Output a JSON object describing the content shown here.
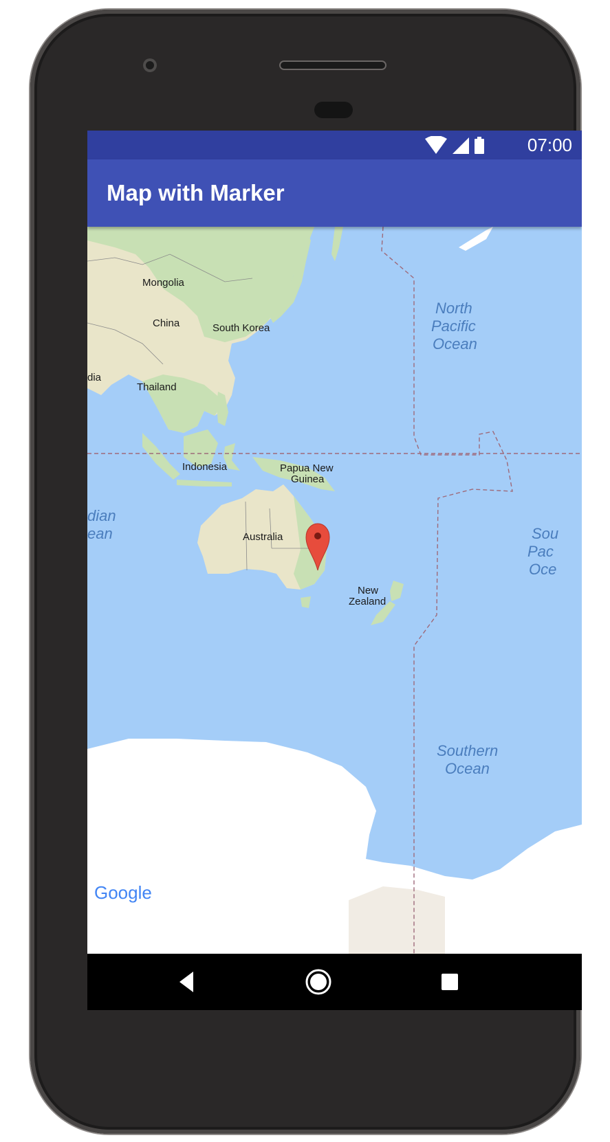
{
  "app": {
    "title": "Map with Marker"
  },
  "status_bar": {
    "time": "07:00",
    "icons": [
      "wifi-icon",
      "cell-signal-icon",
      "battery-icon"
    ]
  },
  "map": {
    "labels": {
      "mongolia": "Mongolia",
      "china": "China",
      "south_korea": "South Korea",
      "india_partial": "dia",
      "thailand": "Thailand",
      "indonesia": "Indonesia",
      "papua_line1": "Papua New",
      "papua_line2": "Guinea",
      "australia": "Australia",
      "nz_line1": "New",
      "nz_line2": "Zealand",
      "north_pacific_line1": "North",
      "north_pacific_line2": "Pacific",
      "north_pacific_line3": "Ocean",
      "indian_line1": "dian",
      "indian_line2": "ean",
      "south_pacific_line1": "Sou",
      "south_pacific_line2": "Pac",
      "south_pacific_line3": "Oce",
      "southern_line1": "Southern",
      "southern_line2": "Ocean"
    },
    "attribution": "Google",
    "colors": {
      "water": "#a4cdf8",
      "land": "#e9e5c9",
      "vegetation": "#c8e0b4",
      "ice": "#ffffff",
      "marker": "#e74c3c",
      "border": "#9e6a7a"
    }
  },
  "nav_bar": {
    "buttons": [
      "back-icon",
      "home-icon",
      "recents-icon"
    ]
  }
}
